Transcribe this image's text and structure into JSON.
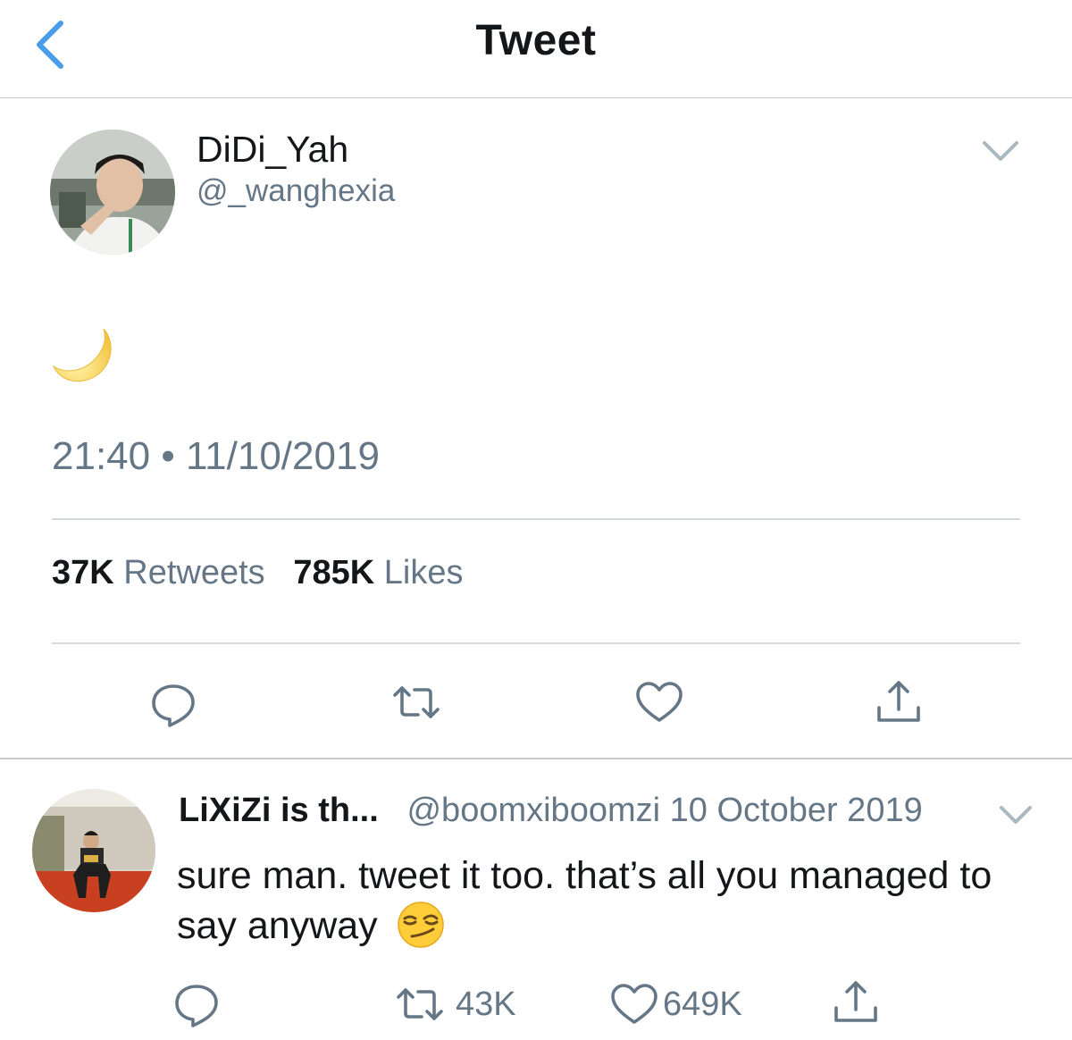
{
  "header": {
    "title": "Tweet",
    "back_icon": "chevron-left-icon"
  },
  "tweet": {
    "display_name": "DiDi_Yah",
    "handle": "@_wanghexia",
    "content_icon": "crescent-moon-emoji",
    "timestamp": "21:40 • 11/10/2019",
    "retweets_count": "37K",
    "retweets_label": "Retweets",
    "likes_count": "785K",
    "likes_label": "Likes"
  },
  "reply": {
    "display_name": "LiXiZi is th...",
    "handle": "@boomxiboomzi",
    "date": "10 October 2019",
    "text": "sure man. tweet it too. that’s all you managed to say anyway",
    "retweet_count": "43K",
    "like_count": "649K"
  },
  "colors": {
    "accent": "#4a9ee8",
    "secondary_text": "#657786",
    "icon_gray": "#657786"
  }
}
